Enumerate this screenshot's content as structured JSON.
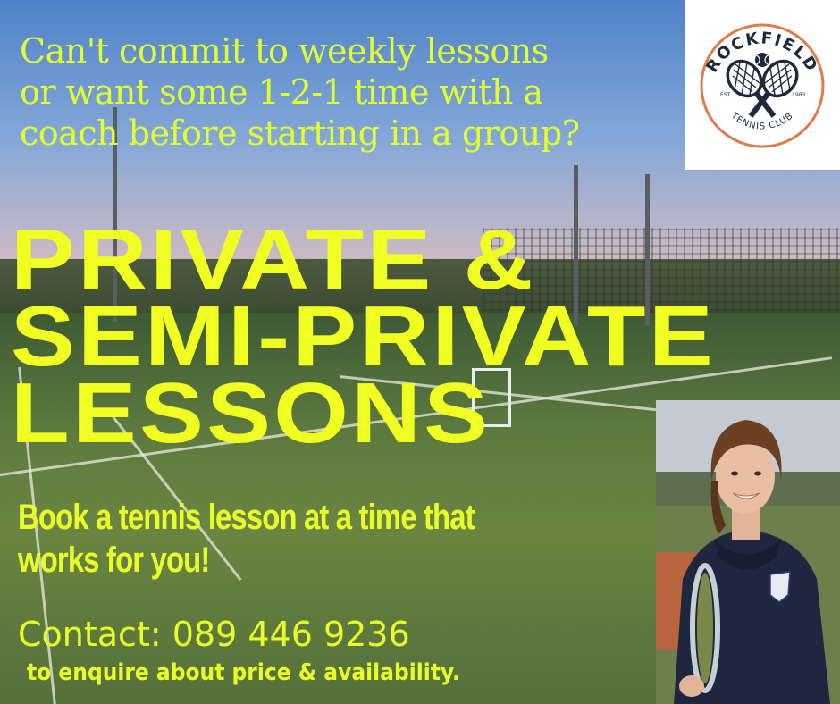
{
  "headline": {
    "lines": [
      "Can't commit to weekly lessons",
      "or want some 1-2-1 time with a",
      "coach before starting in a group?"
    ]
  },
  "title": {
    "lines": [
      "PRIVATE &",
      "SEMI-PRIVATE",
      "LESSONS"
    ]
  },
  "subtitle": {
    "lines": [
      "Book a tennis lesson at a time that",
      "works for you!"
    ]
  },
  "contact": {
    "label": "Contact: 089 446 9236",
    "note": "to enquire about price & availability."
  },
  "logo": {
    "top_text": "ROCKFIELD",
    "bottom_text": "TENNIS CLUB",
    "est_label": "EST",
    "year": "1983"
  },
  "colors": {
    "headline": "#e3ff2e",
    "title": "#f0ff21",
    "logo_ring": "#e07a4c",
    "logo_ink": "#1e2a3a"
  },
  "icons": [
    "tennis-rackets-icon",
    "tennis-ball-icon",
    "coach-photo"
  ]
}
